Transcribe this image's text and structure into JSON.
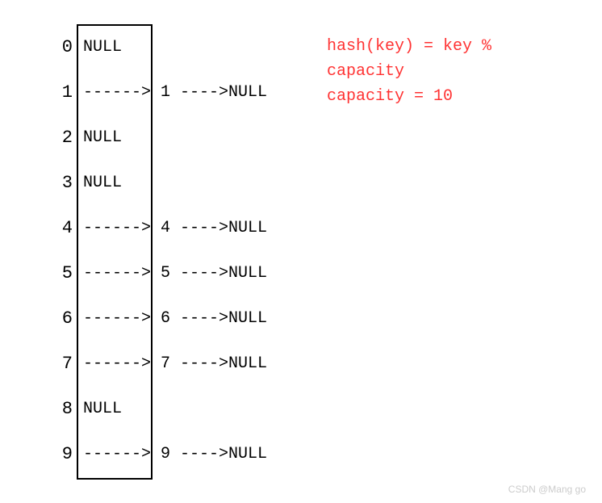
{
  "hash_table": {
    "rows": [
      {
        "index": "0",
        "content": "NULL"
      },
      {
        "index": "1",
        "content": "------> 1 ---->NULL"
      },
      {
        "index": "2",
        "content": "NULL"
      },
      {
        "index": "3",
        "content": "NULL"
      },
      {
        "index": "4",
        "content": "------> 4 ---->NULL"
      },
      {
        "index": "5",
        "content": "------> 5 ---->NULL"
      },
      {
        "index": "6",
        "content": "------> 6 ---->NULL"
      },
      {
        "index": "7",
        "content": "------> 7 ---->NULL"
      },
      {
        "index": "8",
        "content": "NULL"
      },
      {
        "index": "9",
        "content": "------> 9 ---->NULL"
      }
    ]
  },
  "annotation": {
    "line1": "hash(key) = key %",
    "line2": "capacity",
    "line3": "capacity = 10"
  },
  "watermark": "CSDN @Mang go"
}
